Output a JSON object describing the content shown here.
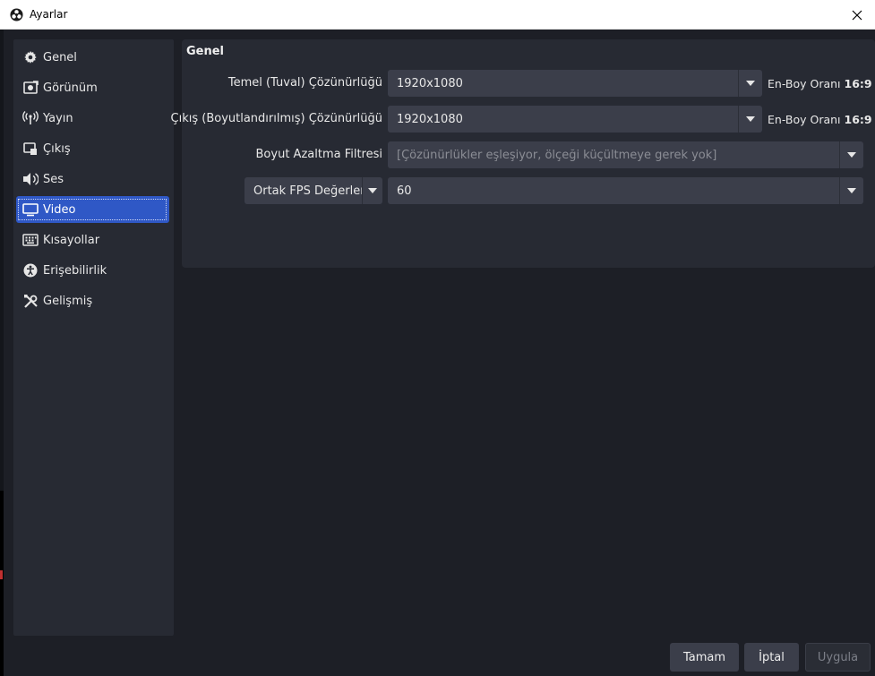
{
  "window": {
    "title": "Ayarlar",
    "app_icon": "obs-icon",
    "close_icon": "close-icon"
  },
  "sidebar": {
    "items": [
      {
        "label": "Genel",
        "icon": "gear-icon"
      },
      {
        "label": "Görünüm",
        "icon": "appearance-icon"
      },
      {
        "label": "Yayın",
        "icon": "broadcast-icon"
      },
      {
        "label": "Çıkış",
        "icon": "output-icon"
      },
      {
        "label": "Ses",
        "icon": "speaker-icon"
      },
      {
        "label": "Video",
        "icon": "monitor-icon",
        "selected": true
      },
      {
        "label": "Kısayollar",
        "icon": "keyboard-icon"
      },
      {
        "label": "Erişebilirlik",
        "icon": "accessibility-icon"
      },
      {
        "label": "Gelişmiş",
        "icon": "tools-icon"
      }
    ]
  },
  "video": {
    "group_title": "Genel",
    "base_resolution": {
      "label": "Temel (Tuval) Çözünürlüğü",
      "value": "1920x1080",
      "ratio_label": "En-Boy Oranı",
      "ratio_value": "16:9"
    },
    "output_resolution": {
      "label": "Çıkış (Boyutlandırılmış) Çözünürlüğü",
      "value": "1920x1080",
      "ratio_label": "En-Boy Oranı",
      "ratio_value": "16:9"
    },
    "downscale_filter": {
      "label": "Boyut Azaltma Filtresi",
      "value": "[Çözünürlükler eşleşiyor, ölçeği küçültmeye gerek yok]",
      "disabled": true
    },
    "fps": {
      "type_label": "Ortak FPS Değerleri",
      "value": "60"
    }
  },
  "buttons": {
    "ok": "Tamam",
    "cancel": "İptal",
    "apply": "Uygula"
  },
  "colors": {
    "accent": "#2f58c6",
    "background": "#1d1f26",
    "panel": "#272a33",
    "control": "#3b3e4a"
  }
}
